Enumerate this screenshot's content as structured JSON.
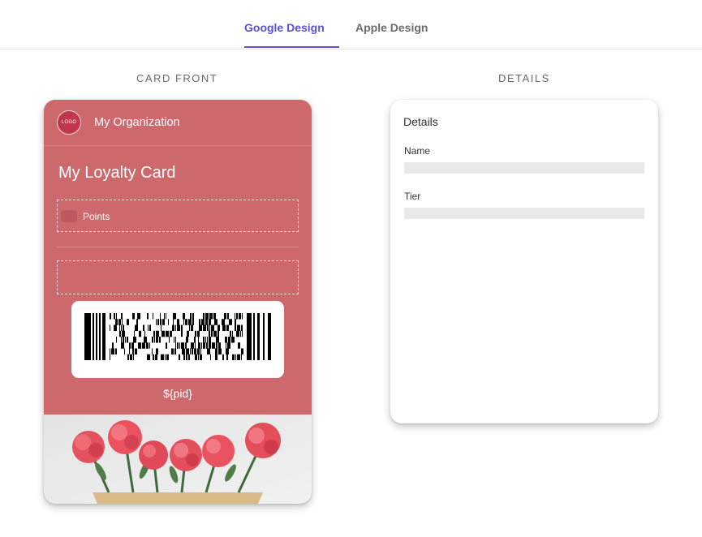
{
  "tabs": [
    {
      "label": "Google Design",
      "active": true
    },
    {
      "label": "Apple Design",
      "active": false
    }
  ],
  "sections": {
    "front_title": "CARD FRONT",
    "details_title": "DETAILS"
  },
  "card": {
    "logo_text": "LOGO",
    "org_name": "My Organization",
    "title": "My Loyalty Card",
    "points_label": "Points",
    "barcode_value": "${pid}",
    "background_color": "#cd686d",
    "hero_image": "pink carnations bouquet"
  },
  "details": {
    "heading": "Details",
    "fields": [
      {
        "label": "Name",
        "value": ""
      },
      {
        "label": "Tier",
        "value": ""
      }
    ]
  },
  "colors": {
    "accent": "#5b4fd6",
    "card": "#cd686d"
  }
}
